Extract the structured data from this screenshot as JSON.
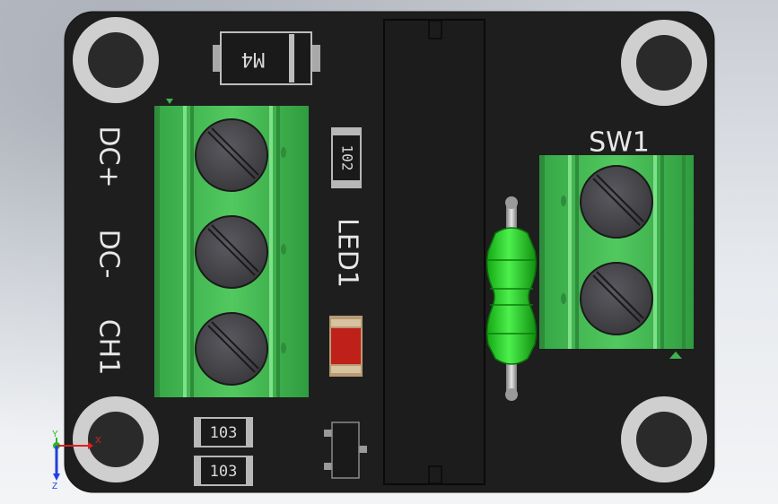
{
  "silkscreen": {
    "label_dc_plus": "DC+",
    "label_dc_minus": "DC-",
    "label_ch1": "CH1",
    "label_led1": "LED1",
    "label_sw1": "SW1"
  },
  "components": {
    "diode_marking": "M4",
    "smd_top_marking": "102",
    "resistor_1_marking": "103",
    "resistor_2_marking": "103"
  },
  "triad": {
    "x_label": "X",
    "y_label": "Y",
    "z_label": "Z"
  },
  "colors": {
    "board": "#1e1e1e",
    "terminal_green": "#3fb34f",
    "screw": "#4a4a4f",
    "led_red": "#c0201a",
    "resistor_green": "#22cc22",
    "silkscreen": "#e8e8e8",
    "mount_hole_ring": "#cfcfcf"
  }
}
